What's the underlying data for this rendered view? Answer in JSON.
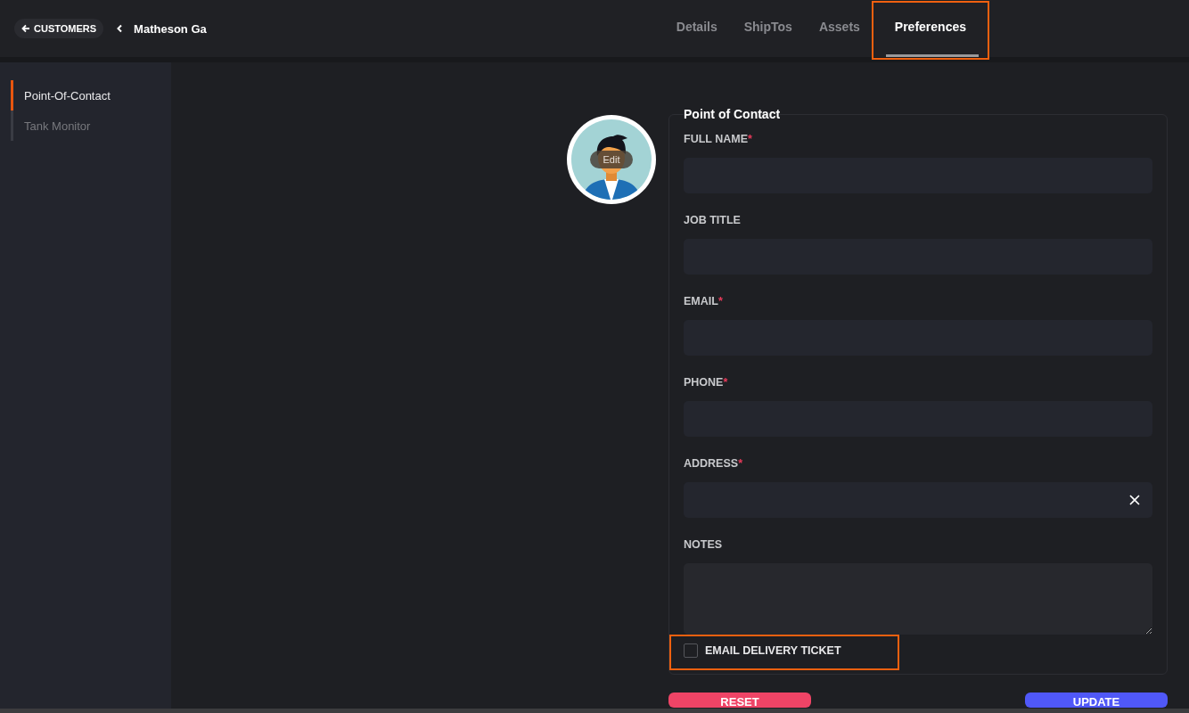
{
  "header": {
    "back_link": "CUSTOMERS",
    "title": "Matheson Ga"
  },
  "tabs": [
    {
      "label": "Details",
      "selected": false,
      "highlighted": false
    },
    {
      "label": "ShipTos",
      "selected": false,
      "highlighted": false
    },
    {
      "label": "Assets",
      "selected": false,
      "highlighted": false
    },
    {
      "label": "Preferences",
      "selected": true,
      "highlighted": true
    }
  ],
  "sidebar": {
    "items": [
      {
        "label": "Point-Of-Contact",
        "selected": true
      },
      {
        "label": "Tank Monitor",
        "selected": false
      }
    ]
  },
  "avatar": {
    "edit_label": "Edit"
  },
  "form": {
    "title": "Point of Contact",
    "fields": [
      {
        "label": "FULL NAME",
        "required_mark": "*",
        "kind": "input"
      },
      {
        "label": "JOB TITLE",
        "kind": "input"
      },
      {
        "label": "EMAIL",
        "required_mark": "*",
        "kind": "input"
      },
      {
        "label": "PHONE",
        "required_mark": "*",
        "kind": "input"
      },
      {
        "label": "ADDRESS",
        "required_mark": "*",
        "kind": "clearable"
      },
      {
        "label": "NOTES",
        "kind": "textarea"
      }
    ],
    "checkbox": {
      "label": "EMAIL DELIVERY TICKET",
      "checked": false,
      "highlighted": true
    },
    "buttons": [
      {
        "label": "RESET",
        "kind": "reset"
      },
      {
        "label": "UPDATE",
        "kind": "submit"
      }
    ]
  }
}
